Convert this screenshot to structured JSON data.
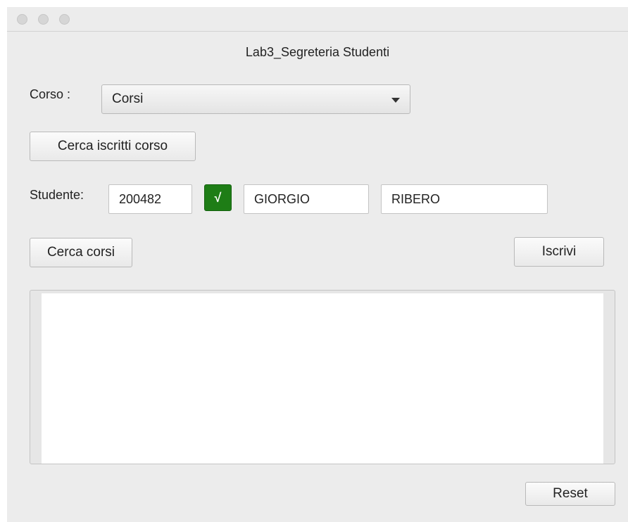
{
  "window": {
    "title": "Lab3_Segreteria Studenti"
  },
  "corso": {
    "label": "Corso :",
    "selected": "Corsi"
  },
  "buttons": {
    "cerca_iscritti": "Cerca iscritti corso",
    "cerca_corsi": "Cerca corsi",
    "iscrivi": "Iscrivi",
    "reset": "Reset",
    "check": "√"
  },
  "studente": {
    "label": "Studente:",
    "matricola": "200482",
    "nome": "GIORGIO",
    "cognome": "RIBERO"
  },
  "results": {
    "text": ""
  },
  "colors": {
    "check_green": "#1e7d16",
    "window_bg": "#ececec"
  }
}
